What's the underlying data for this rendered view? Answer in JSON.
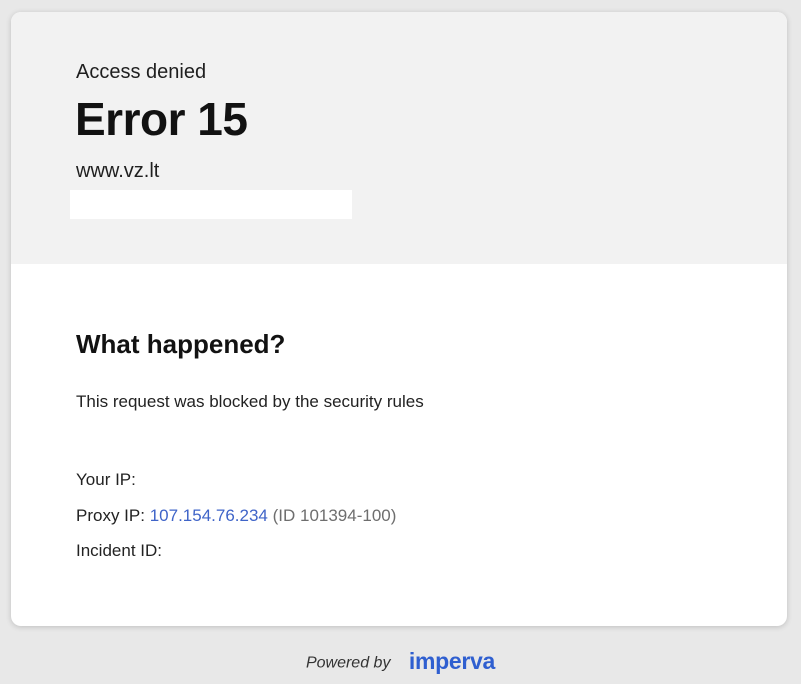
{
  "header": {
    "status_text": "Access denied",
    "error_code": "Error 15",
    "domain": "www.vz.lt"
  },
  "details": {
    "heading": "What happened?",
    "description": "This request was blocked by the security rules",
    "your_ip_label": "Your IP:",
    "proxy_ip_label": "Proxy IP:",
    "proxy_ip_value": "107.154.76.234",
    "proxy_id": "(ID 101394-100)",
    "incident_id_label": "Incident ID:"
  },
  "footer": {
    "powered_by": "Powered by",
    "brand": "imperva"
  },
  "colors": {
    "page_background": "#e8e8e8",
    "card_top_background": "#f2f2f2",
    "link": "#3f64c8",
    "brand": "#2f5fd0"
  }
}
